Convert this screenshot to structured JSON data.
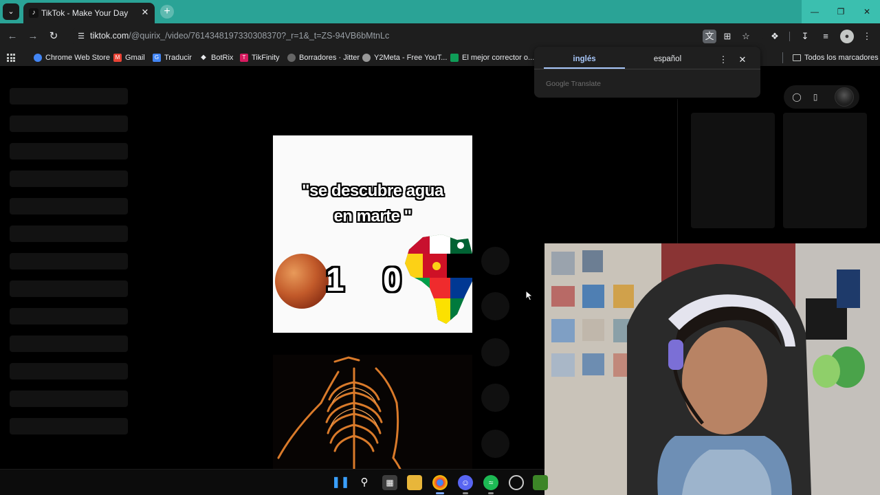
{
  "browser": {
    "tab": {
      "title": "TikTok - Make Your Day"
    },
    "url": {
      "host": "tiktok.com",
      "path": "/@quirix_/video/7614348197330308370?_r=1&_t=ZS-94VB6bMtnLc"
    }
  },
  "bookmarks": {
    "items": [
      {
        "label": "Chrome Web Store",
        "color": "#4285f4"
      },
      {
        "label": "Gmail",
        "color": "#ea4335"
      },
      {
        "label": "Traducir",
        "color": "#4285f4"
      },
      {
        "label": "BotRix",
        "color": "#e8eaed"
      },
      {
        "label": "TikFinity",
        "color": "#d81b60"
      },
      {
        "label": "Borradores · Jitter",
        "color": "#888888"
      },
      {
        "label": "Y2Meta - Free YouT...",
        "color": "#bbbbbb"
      },
      {
        "label": "El mejor corrector o...",
        "color": "#0f9d58"
      }
    ],
    "all_bookmarks": "Todos los marcadores"
  },
  "translate_popup": {
    "source_lang": "inglés",
    "target_lang": "español",
    "brand": "Google Translate"
  },
  "video": {
    "caption_line1": "\"se descubre agua",
    "caption_line2": "en marte \"",
    "score_left": "1",
    "score_right": "0"
  },
  "colors": {
    "titlebar": "#2aa396",
    "toolbar": "#1e1e1e",
    "accent": "#a8c7fa",
    "page_bg": "#000000"
  }
}
